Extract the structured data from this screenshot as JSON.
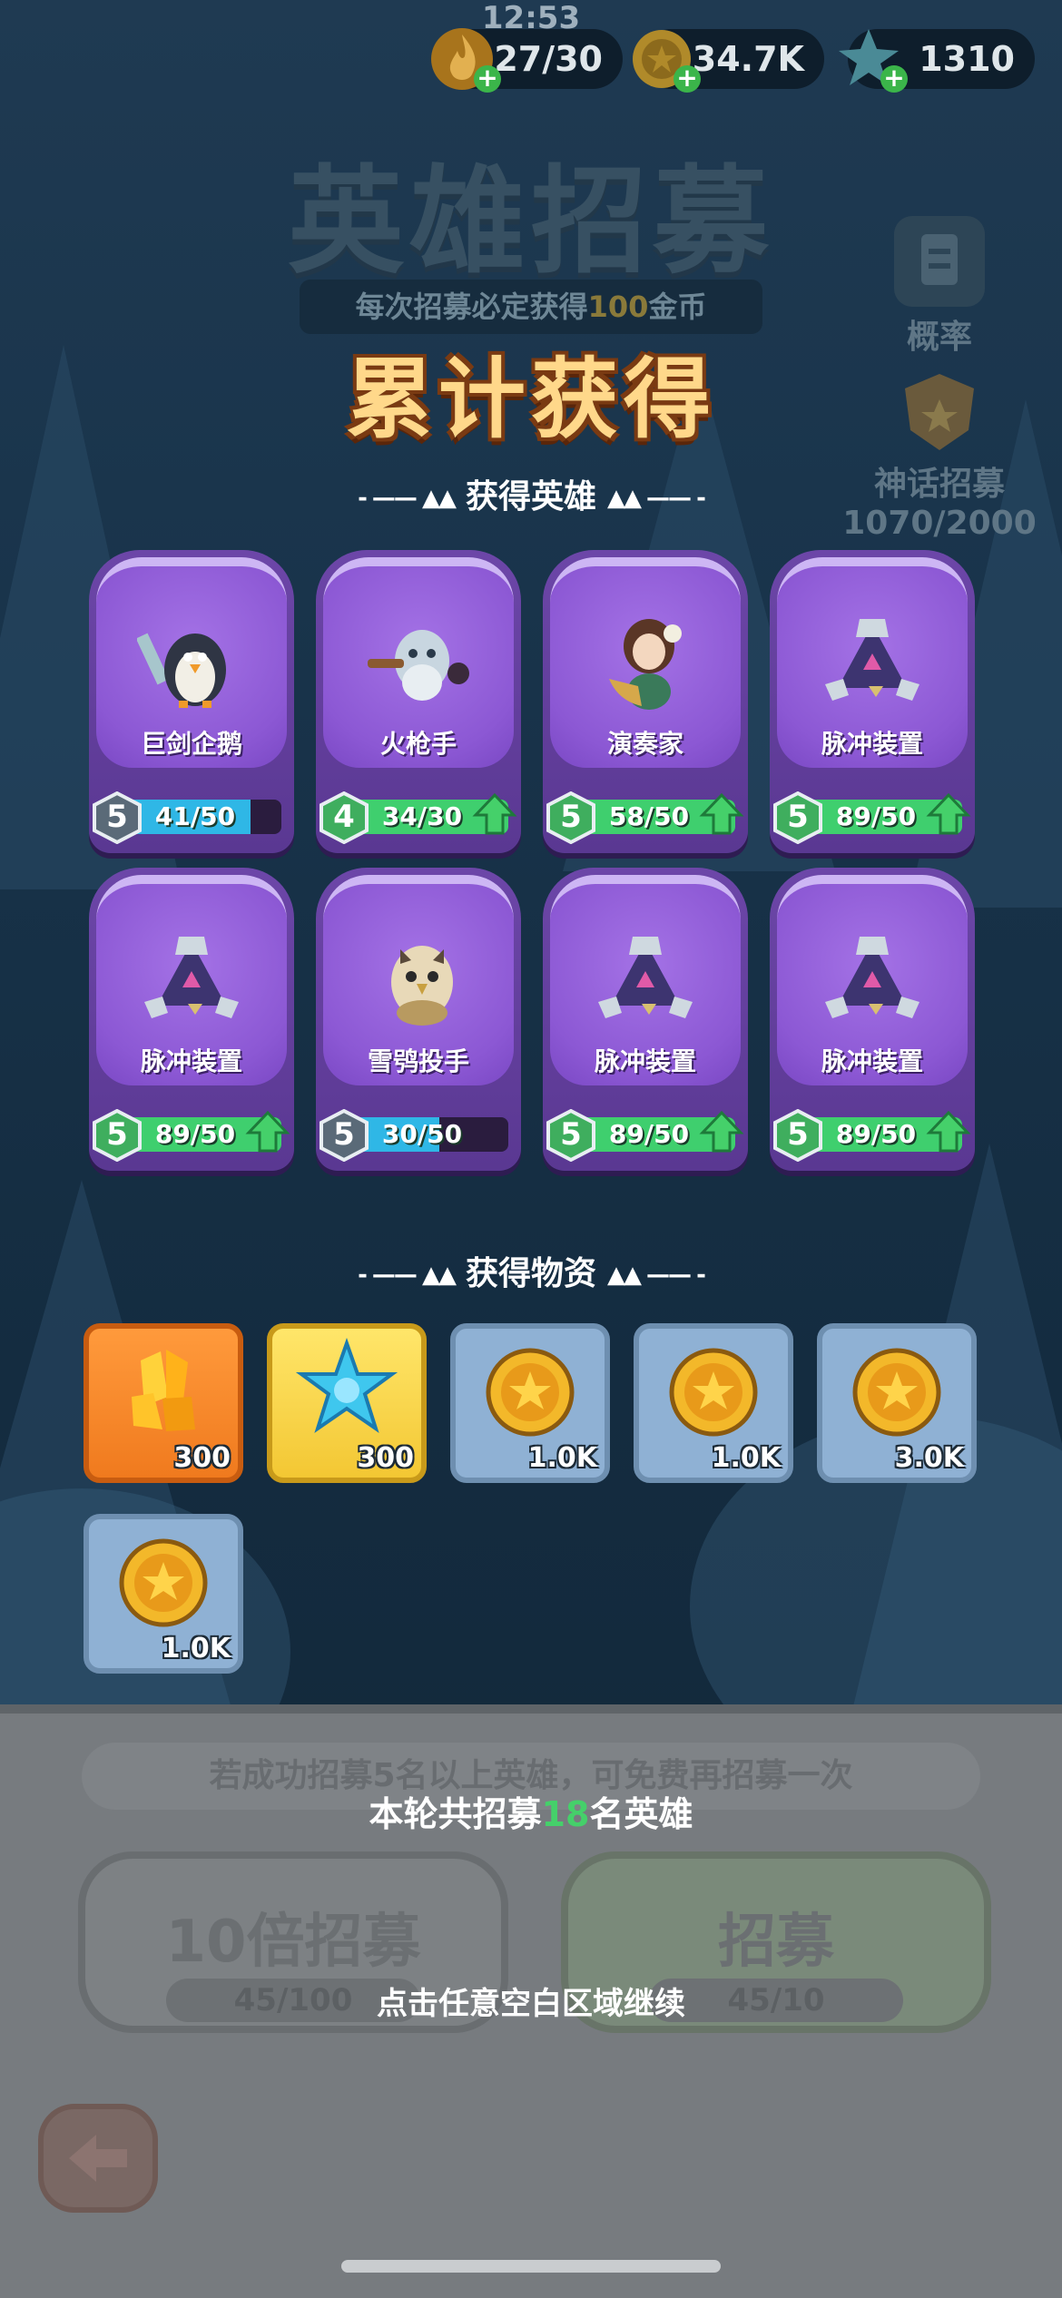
{
  "status": {
    "time": "12:53"
  },
  "resources": [
    {
      "name": "energy",
      "value": "27/30",
      "icon": "energy-flame-icon"
    },
    {
      "name": "gold",
      "value": "34.7K",
      "icon": "gold-coin-icon"
    },
    {
      "name": "crystal",
      "value": "1310",
      "icon": "snowflake-crystal-icon"
    }
  ],
  "header": {
    "title": "英雄招募",
    "banner_prefix": "每次招募必定获得",
    "banner_amount": "100",
    "banner_suffix": "金币"
  },
  "side": {
    "probability_label": "概率",
    "myth_label": "神话招募",
    "myth_progress": "1070/2000"
  },
  "result": {
    "title": "累计获得",
    "heroes_section": "获得英雄",
    "items_section": "获得物资"
  },
  "heroes": [
    {
      "name": "巨剑企鹅",
      "level": "5",
      "progress": "41/50",
      "fill": 0.82,
      "upgradable": false,
      "portrait": "penguin-sword-portrait"
    },
    {
      "name": "火枪手",
      "level": "4",
      "progress": "34/30",
      "fill": 1.0,
      "upgradable": true,
      "portrait": "musketeer-portrait"
    },
    {
      "name": "演奏家",
      "level": "5",
      "progress": "58/50",
      "fill": 1.0,
      "upgradable": true,
      "portrait": "harpist-portrait"
    },
    {
      "name": "脉冲装置",
      "level": "5",
      "progress": "89/50",
      "fill": 1.0,
      "upgradable": true,
      "portrait": "pulse-device-portrait"
    },
    {
      "name": "脉冲装置",
      "level": "5",
      "progress": "89/50",
      "fill": 1.0,
      "upgradable": true,
      "portrait": "pulse-device-portrait"
    },
    {
      "name": "雪鸮投手",
      "level": "5",
      "progress": "30/50",
      "fill": 0.6,
      "upgradable": false,
      "portrait": "snow-owl-portrait"
    },
    {
      "name": "脉冲装置",
      "level": "5",
      "progress": "89/50",
      "fill": 1.0,
      "upgradable": true,
      "portrait": "pulse-device-portrait"
    },
    {
      "name": "脉冲装置",
      "level": "5",
      "progress": "89/50",
      "fill": 1.0,
      "upgradable": true,
      "portrait": "pulse-device-portrait"
    }
  ],
  "items": [
    {
      "type": "orange",
      "icon": "gold-crystal-icon",
      "count": "300"
    },
    {
      "type": "yellow",
      "icon": "blue-snowflake-icon",
      "count": "300"
    },
    {
      "type": "blue",
      "icon": "gold-coin-icon",
      "count": "1.0K"
    },
    {
      "type": "blue",
      "icon": "gold-coin-icon",
      "count": "1.0K"
    },
    {
      "type": "blue",
      "icon": "gold-coin-icon",
      "count": "3.0K"
    },
    {
      "type": "blue",
      "icon": "gold-coin-icon",
      "count": "1.0K"
    }
  ],
  "bottom": {
    "free_hint": "若成功招募5名以上英雄，可免费再招募一次",
    "recruit_prefix": "本轮共招募",
    "recruit_count": "18",
    "recruit_suffix": "名英雄",
    "ten_x_label": "10倍招募",
    "ten_x_cost": "45/100",
    "single_label": "招募",
    "single_cost": "45/10",
    "continue_hint": "点击任意空白区域继续"
  },
  "colors": {
    "accent_gold": "#ffd88a",
    "green": "#45d06a",
    "blue_bar": "#2fb7e6",
    "card_purple": "#8c58d4"
  }
}
